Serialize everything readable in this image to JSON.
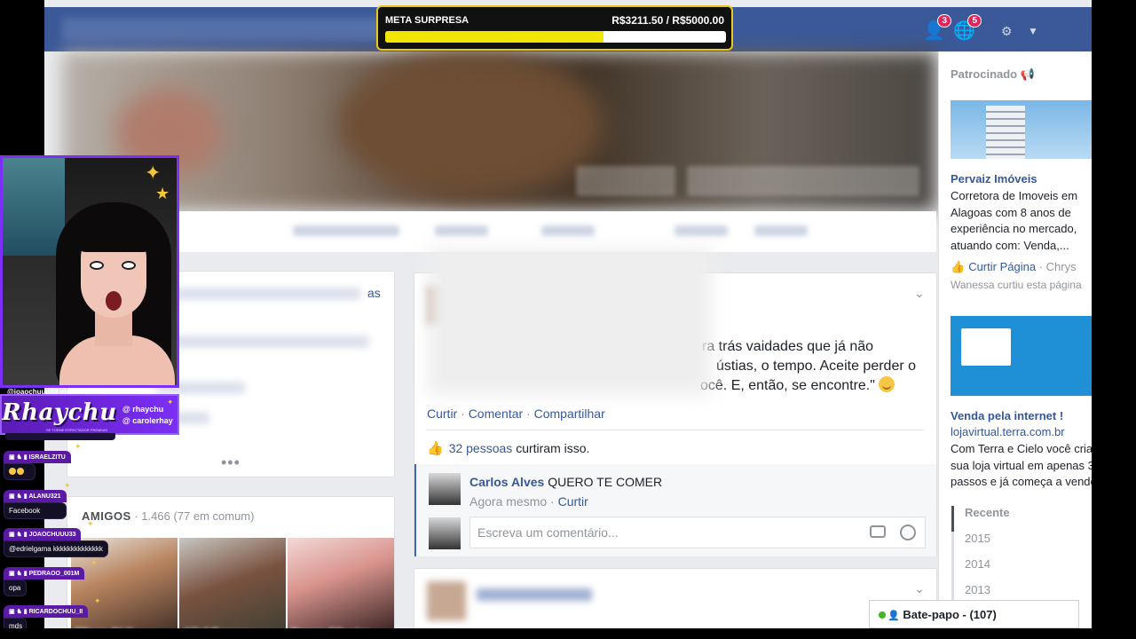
{
  "goal": {
    "label": "META SURPRESA",
    "amount": "R$3211.50 / R$5000.00",
    "progress": 0.64,
    "fill_color": "#f2e600"
  },
  "topbar": {
    "notif_friends_count": "3",
    "notif_globe_count": "5",
    "icons": [
      "friend-requests-icon",
      "globe-notifications-icon",
      "quick-help-icon",
      "account-menu-icon"
    ]
  },
  "left": {
    "partial_text": "as",
    "more_dots": "•••",
    "friends_title": "AMIGOS",
    "friends_count": "· 1.466 (77 em comum)"
  },
  "post": {
    "lines": [
      "ra trás vaidades que já não",
      "ústias, o tempo. Aceite perder o",
      "ocê. E, então, se encontre.\""
    ],
    "actions": {
      "like": "Curtir",
      "comment": "Comentar",
      "share": "Compartilhar",
      "sep": "·"
    },
    "likes": {
      "count": "32 pessoas",
      "text": "curtiram isso."
    },
    "comment": {
      "author": "Carlos Alves",
      "text": "QUERO TE COMER",
      "time": "Agora mesmo",
      "like": "Curtir"
    },
    "comment_placeholder": "Escreva um comentário..."
  },
  "right": {
    "sponsored": "Patrocinado",
    "ad1": {
      "title": "Pervaiz Imóveis",
      "desc": [
        "Corretora de Imoveis em",
        "Alagoas com 8 anos de",
        "experiência no mercado,",
        "atuando com: Venda,..."
      ],
      "like": "Curtir Página",
      "like_extra": "· Chrys",
      "liked_by": "Wanessa curtiu esta página"
    },
    "ad2": {
      "title": "Venda pela internet !",
      "link": "lojavirtual.terra.com.br",
      "desc": [
        "Com Terra e Cielo você cria",
        "sua loja virtual em apenas 3",
        "passos e já começa a vende"
      ]
    },
    "years": [
      "Recente",
      "2015",
      "2014",
      "2013"
    ]
  },
  "chatbar": {
    "label": "Bate-papo - (107)"
  },
  "stream": {
    "brand": "Rhaychu",
    "tagline": "SE TORNE ESPECTADOR PREMIUM",
    "handles": [
      "@ rhaychu",
      "@ carolerhay"
    ],
    "top_snippet": "@joaochuuu33 pior que é verdade kkkkk",
    "messages": [
      {
        "user": "ISRAELZITU",
        "text": ""
      },
      {
        "user": "ALANU321",
        "text": "Facebook"
      },
      {
        "user": "JOAOCHUUU33",
        "text": "@edrielgama kkkkkkkkkkkkkk"
      },
      {
        "user": "PEDRAOO_001M",
        "text": "opa"
      },
      {
        "user": "RICARDOCHUU_II",
        "text": "mds"
      }
    ]
  }
}
